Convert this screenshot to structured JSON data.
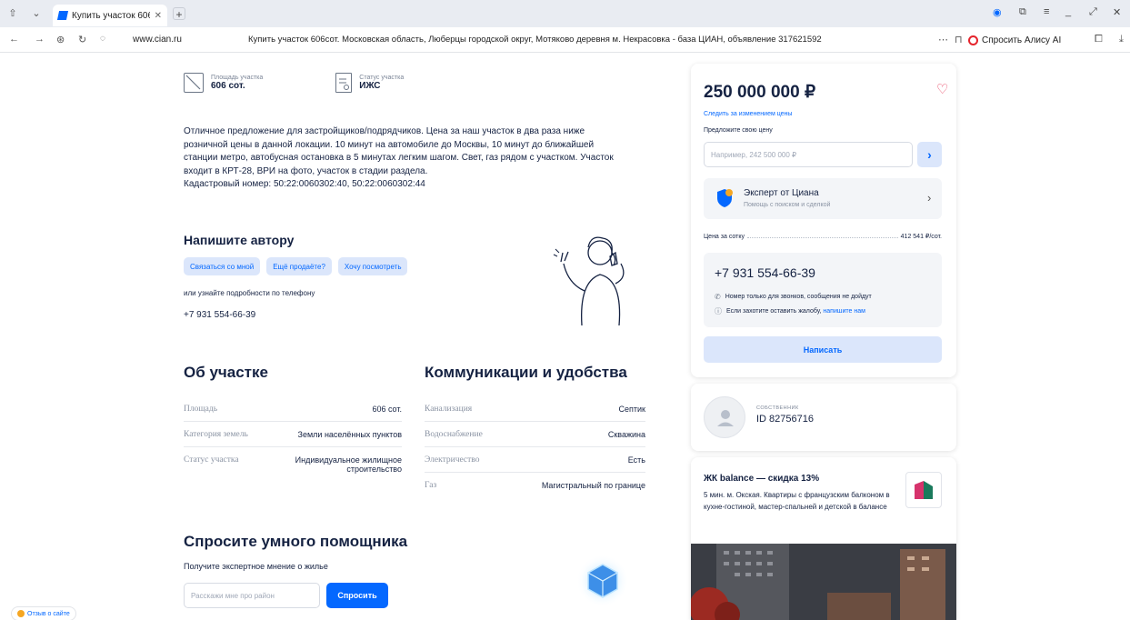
{
  "browser": {
    "tab_title": "Купить участок 606сот",
    "url_host": "www.cian.ru",
    "url_title": "Купить участок 606сот. Московская область, Люберцы городской округ, Мотяково деревня м. Некрасовка - база ЦИАН, объявление 317621592",
    "alice_label": "Спросить Алису AI"
  },
  "params": [
    {
      "label": "Площадь участка",
      "value": "606 сот."
    },
    {
      "label": "Статус участка",
      "value": "ИЖС"
    }
  ],
  "description": {
    "text": "Отличное предложение для застройщиков/подрядчиков. Цена за наш участок в два раза ниже розничной цены в данной локации. 10 минут на автомобиле до Москвы, 10 минут до ближайшей станции метро, автобусная остановка в 5 минутах легким шагом. Свет, газ рядом с участком. Участок входит в КРТ-28, ВРИ на фото, участок в стадии раздела.",
    "cadastral": "Кадастровый номер: 50:22:0060302:40, 50:22:0060302:44"
  },
  "write_author": {
    "title": "Напишите автору",
    "chips": [
      "Связаться со мной",
      "Ещё продаёте?",
      "Хочу посмотреть"
    ],
    "or_phone": "или узнайте подробности по телефону",
    "phone": "+7 931 554-66-39"
  },
  "about": {
    "title": "Об участке",
    "rows": [
      {
        "k": "Площадь",
        "v": "606 сот."
      },
      {
        "k": "Категория земель",
        "v": "Земли населённых пунктов"
      },
      {
        "k": "Статус участка",
        "v": "Индивидуальное жилищное строительство"
      }
    ]
  },
  "communications": {
    "title": "Коммуникации и удобства",
    "rows": [
      {
        "k": "Канализация",
        "v": "Септик"
      },
      {
        "k": "Водоснабжение",
        "v": "Скважина"
      },
      {
        "k": "Электричество",
        "v": "Есть"
      },
      {
        "k": "Газ",
        "v": "Магистральный по границе"
      }
    ]
  },
  "assistant": {
    "title": "Спросите умного помощника",
    "subtitle": "Получите экспертное мнение о жилье",
    "placeholder": "Расскажи мне про район",
    "button": "Спросить"
  },
  "feedback_label": "Отзыв о сайте",
  "price_card": {
    "price": "250 000 000 ₽",
    "watch_link": "Следить за изменением цены",
    "offer_label": "Предложите свою цену",
    "offer_placeholder": "Например, 242 500 000 ₽",
    "expert_title": "Эксперт от Циана",
    "expert_sub": "Помощь с поиском и сделкой",
    "per_label": "Цена за сотку",
    "per_value": "412 541 ₽/сот.",
    "phone": "+7 931 554-66-39",
    "note1": "Номер только для звонков, сообщения не дойдут",
    "note2_prefix": "Если захотите оставить жалобу,",
    "note2_link": "напишите нам",
    "write_button": "Написать"
  },
  "owner": {
    "role": "СОБСТВЕННИК",
    "id": "ID 82756716"
  },
  "ad": {
    "title": "ЖК balance — скидка 13%",
    "text": "5 мин. м. Окская. Квартиры с французским балконом в кухне-гостиной, мастер-спальней и детской в балансе"
  },
  "colors": {
    "accent": "#0468ff",
    "chip_bg": "#dbe6fb",
    "heart": "#e84260"
  }
}
